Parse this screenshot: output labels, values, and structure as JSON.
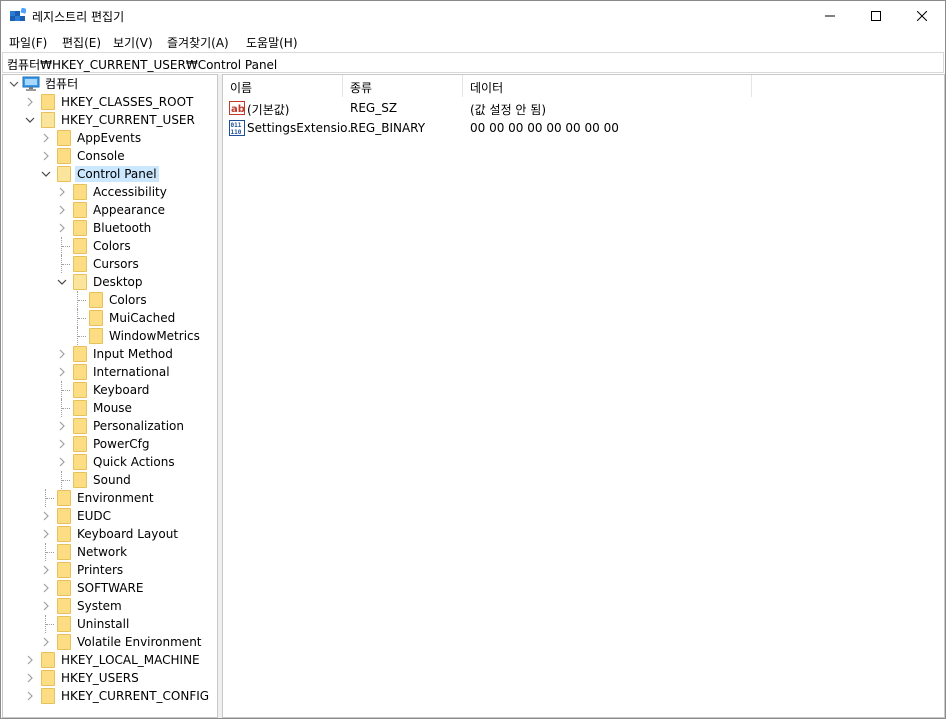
{
  "window": {
    "title": "레지스트리 편집기"
  },
  "menu": [
    "파일(F)",
    "편집(E)",
    "보기(V)",
    "즐겨찾기(A)",
    "도움말(H)"
  ],
  "address": "컴퓨터₩HKEY_CURRENT_USER₩Control Panel",
  "tree": {
    "root": "컴퓨터",
    "items": [
      {
        "label": "HKEY_CLASSES_ROOT",
        "level": 1,
        "expander": "collapsed"
      },
      {
        "label": "HKEY_CURRENT_USER",
        "level": 1,
        "expander": "expanded"
      },
      {
        "label": "AppEvents",
        "level": 2,
        "expander": "collapsed"
      },
      {
        "label": "Console",
        "level": 2,
        "expander": "collapsed"
      },
      {
        "label": "Control Panel",
        "level": 2,
        "expander": "expanded",
        "selected": true
      },
      {
        "label": "Accessibility",
        "level": 3,
        "expander": "collapsed"
      },
      {
        "label": "Appearance",
        "level": 3,
        "expander": "collapsed"
      },
      {
        "label": "Bluetooth",
        "level": 3,
        "expander": "collapsed"
      },
      {
        "label": "Colors",
        "level": 3,
        "expander": "none"
      },
      {
        "label": "Cursors",
        "level": 3,
        "expander": "none"
      },
      {
        "label": "Desktop",
        "level": 3,
        "expander": "expanded"
      },
      {
        "label": "Colors",
        "level": 4,
        "expander": "none"
      },
      {
        "label": "MuiCached",
        "level": 4,
        "expander": "none"
      },
      {
        "label": "WindowMetrics",
        "level": 4,
        "expander": "none"
      },
      {
        "label": "Input Method",
        "level": 3,
        "expander": "collapsed"
      },
      {
        "label": "International",
        "level": 3,
        "expander": "collapsed"
      },
      {
        "label": "Keyboard",
        "level": 3,
        "expander": "none"
      },
      {
        "label": "Mouse",
        "level": 3,
        "expander": "none"
      },
      {
        "label": "Personalization",
        "level": 3,
        "expander": "collapsed"
      },
      {
        "label": "PowerCfg",
        "level": 3,
        "expander": "collapsed"
      },
      {
        "label": "Quick Actions",
        "level": 3,
        "expander": "collapsed"
      },
      {
        "label": "Sound",
        "level": 3,
        "expander": "none"
      },
      {
        "label": "Environment",
        "level": 2,
        "expander": "none"
      },
      {
        "label": "EUDC",
        "level": 2,
        "expander": "collapsed"
      },
      {
        "label": "Keyboard Layout",
        "level": 2,
        "expander": "collapsed"
      },
      {
        "label": "Network",
        "level": 2,
        "expander": "none"
      },
      {
        "label": "Printers",
        "level": 2,
        "expander": "collapsed"
      },
      {
        "label": "SOFTWARE",
        "level": 2,
        "expander": "collapsed"
      },
      {
        "label": "System",
        "level": 2,
        "expander": "collapsed"
      },
      {
        "label": "Uninstall",
        "level": 2,
        "expander": "none"
      },
      {
        "label": "Volatile Environment",
        "level": 2,
        "expander": "collapsed"
      },
      {
        "label": "HKEY_LOCAL_MACHINE",
        "level": 1,
        "expander": "collapsed"
      },
      {
        "label": "HKEY_USERS",
        "level": 1,
        "expander": "collapsed"
      },
      {
        "label": "HKEY_CURRENT_CONFIG",
        "level": 1,
        "expander": "collapsed"
      }
    ]
  },
  "list": {
    "columns": [
      "이름",
      "종류",
      "데이터"
    ],
    "rows": [
      {
        "icon": "string-value-icon",
        "name": "(기본값)",
        "type": "REG_SZ",
        "data": "(값 설정 안 됨)"
      },
      {
        "icon": "binary-value-icon",
        "name": "SettingsExtensio...",
        "type": "REG_BINARY",
        "data": "00 00 00 00 00 00 00 00"
      }
    ]
  },
  "colors": {
    "selection": "#cce8ff",
    "folder": "#fcdd84"
  }
}
